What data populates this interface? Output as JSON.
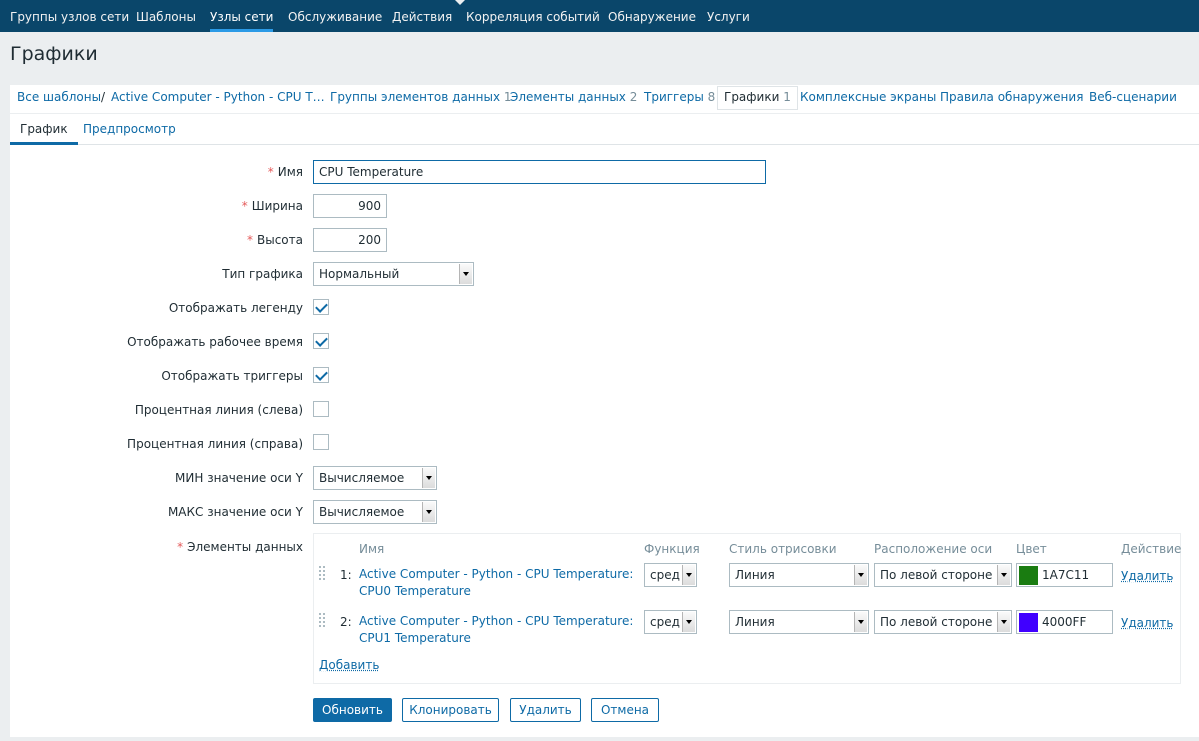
{
  "topnav": {
    "items": [
      "Группы узлов сети",
      "Шаблоны",
      "Узлы сети",
      "Обслуживание",
      "Действия",
      "Корреляция событий",
      "Обнаружение",
      "Услуги"
    ],
    "active_index": 2
  },
  "page_title": "Графики",
  "breadcrumbs": {
    "all_templates": "Все шаблоны",
    "separator": "/",
    "template": "Active Computer - Python - CPU T…",
    "links": [
      {
        "label": "Группы элементов данных",
        "count": "1"
      },
      {
        "label": "Элементы данных",
        "count": "2"
      },
      {
        "label": "Триггеры",
        "count": "8"
      },
      {
        "label": "Графики",
        "count": "1"
      },
      {
        "label": "Комплексные экраны",
        "count": ""
      },
      {
        "label": "Правила обнаружения",
        "count": ""
      },
      {
        "label": "Веб-сценарии",
        "count": ""
      }
    ]
  },
  "tabs": [
    "График",
    "Предпросмотр"
  ],
  "form": {
    "required_mark": "*",
    "name_label": "Имя",
    "name_value": "CPU Temperature",
    "width_label": "Ширина",
    "width_value": "900",
    "height_label": "Высота",
    "height_value": "200",
    "graph_type_label": "Тип графика",
    "graph_type_value": "Нормальный",
    "show_legend_label": "Отображать легенду",
    "show_legend": true,
    "show_worktime_label": "Отображать рабочее время",
    "show_worktime": true,
    "show_triggers_label": "Отображать триггеры",
    "show_triggers": true,
    "percent_left_label": "Процентная линия (слева)",
    "percent_left": false,
    "percent_right_label": "Процентная линия (справа)",
    "percent_right": false,
    "ymin_label": "МИН значение оси Y",
    "ymin_value": "Вычисляемое",
    "ymax_label": "МАКС значение оси Y",
    "ymax_value": "Вычисляемое",
    "items_label": "Элементы данных"
  },
  "items_table": {
    "headers": {
      "name": "Имя",
      "function": "Функция",
      "draw_style": "Стиль отрисовки",
      "y_axis_side": "Расположение оси",
      "color": "Цвет",
      "action": "Действие"
    },
    "rows": [
      {
        "num": "1:",
        "name_line1": "Active Computer - Python - CPU Temperature:",
        "name_line2": "CPU0 Temperature",
        "function": "сред",
        "draw_style": "Линия",
        "y_axis_side": "По левой стороне",
        "color": "1A7C11",
        "color_hex": "#1A7C11",
        "action": "Удалить"
      },
      {
        "num": "2:",
        "name_line1": "Active Computer - Python - CPU Temperature:",
        "name_line2": "CPU1 Temperature",
        "function": "сред",
        "draw_style": "Линия",
        "y_axis_side": "По левой стороне",
        "color": "4000FF",
        "color_hex": "#4000FF",
        "action": "Удалить"
      }
    ],
    "add_label": "Добавить"
  },
  "buttons": {
    "update": "Обновить",
    "clone": "Клонировать",
    "delete": "Удалить",
    "cancel": "Отмена"
  },
  "colors": {
    "header_bg": "#0a466a",
    "link": "#0e6aa6",
    "required": "#e45959"
  }
}
